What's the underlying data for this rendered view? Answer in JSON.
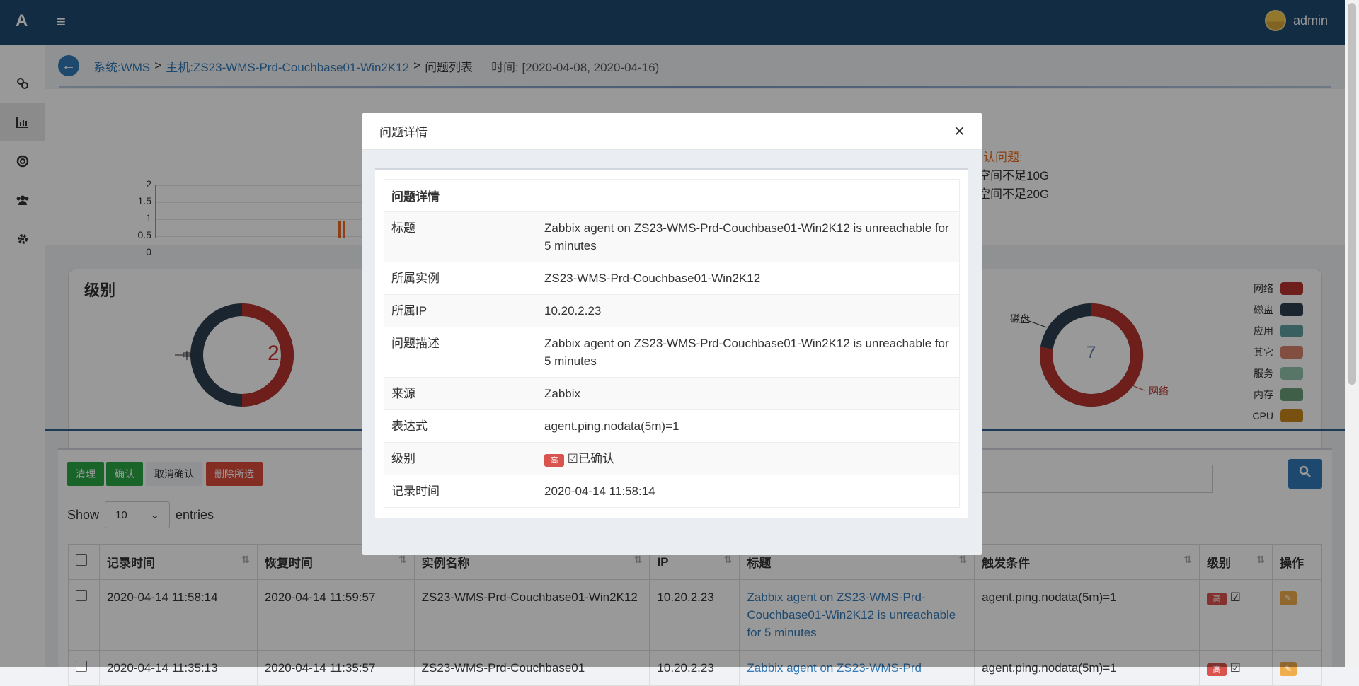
{
  "topbar": {
    "logo": "A",
    "menu_icon": "≡",
    "user": "admin"
  },
  "sidebar": {
    "icons": [
      "link-icon",
      "bar-chart-icon",
      "life-ring-icon",
      "users-icon",
      "gear-icon"
    ]
  },
  "breadcrumb": {
    "system": "系统:WMS",
    "sep1": ">",
    "host": "主机:ZS23-WMS-Prd-Couchbase01-Win2K12",
    "sep2": ">",
    "page": "问题列表",
    "time": "时间: [2020-04-08, 2020-04-16)"
  },
  "trend": {
    "ylabels": [
      "2",
      "1.5",
      "1",
      "0.5",
      "0"
    ]
  },
  "alerts": {
    "title": "最近的未确认问题:",
    "items": [
      "空间不足10G",
      "空间不足20G"
    ]
  },
  "level_panel": {
    "title": "级别",
    "left_label": "中",
    "left_total": "2",
    "right_total": "7",
    "right_labels": [
      "磁盘",
      "网络"
    ],
    "legend": [
      {
        "name": "网络",
        "color": "#b8352f"
      },
      {
        "name": "磁盘",
        "color": "#2c3e50"
      },
      {
        "name": "应用",
        "color": "#5f9ea0"
      },
      {
        "name": "其它",
        "color": "#d7826a"
      },
      {
        "name": "服务",
        "color": "#92c5ae"
      },
      {
        "name": "内存",
        "color": "#6b9f7a"
      },
      {
        "name": "CPU",
        "color": "#c8871c"
      }
    ]
  },
  "toolbar": {
    "clear": "清理",
    "confirm": "确认",
    "unconfirm": "取消确认",
    "delete": "删除所选"
  },
  "table": {
    "show": "Show",
    "entries": "entries",
    "page_size": "10",
    "headers": [
      "记录时间",
      "恢复时间",
      "实例名称",
      "IP",
      "标题",
      "触发条件",
      "级别",
      "操作"
    ],
    "rows": [
      {
        "record": "2020-04-14 11:58:14",
        "recover": "2020-04-14 11:59:57",
        "instance": "ZS23-WMS-Prd-Couchbase01-Win2K12",
        "ip": "10.20.2.23",
        "title": "Zabbix agent on ZS23-WMS-Prd-Couchbase01-Win2K12 is unreachable for 5 minutes",
        "trigger": "agent.ping.nodata(5m)=1",
        "level": "高"
      },
      {
        "record": "2020-04-14 11:35:13",
        "recover": "2020-04-14 11:35:57",
        "instance": "ZS23-WMS-Prd-Couchbase01",
        "ip": "10.20.2.23",
        "title": "Zabbix agent on ZS23-WMS-Prd",
        "trigger": "agent.ping.nodata(5m)=1",
        "level": "高"
      }
    ]
  },
  "modal": {
    "title": "问题详情",
    "close": "×",
    "section": "问题详情",
    "fields": [
      {
        "key": "标题",
        "value": "Zabbix agent on ZS23-WMS-Prd-Couchbase01-Win2K12 is unreachable for 5 minutes"
      },
      {
        "key": "所属实例",
        "value": "ZS23-WMS-Prd-Couchbase01-Win2K12"
      },
      {
        "key": "所属IP",
        "value": "10.20.2.23"
      },
      {
        "key": "问题描述",
        "value": "Zabbix agent on ZS23-WMS-Prd-Couchbase01-Win2K12 is unreachable for 5 minutes"
      },
      {
        "key": "来源",
        "value": "Zabbix"
      },
      {
        "key": "表达式",
        "value": "agent.ping.nodata(5m)=1"
      },
      {
        "key": "级别",
        "value": "已确认",
        "badge": "高"
      },
      {
        "key": "记录时间",
        "value": "2020-04-14 11:58:14"
      }
    ]
  }
}
